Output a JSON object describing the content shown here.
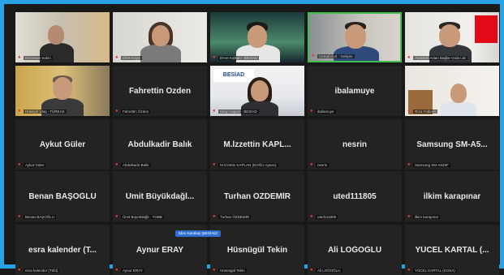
{
  "window": {
    "accent_color": "#2aa3e6",
    "active_speaker_color": "#3fbf4f"
  },
  "row1": [
    {
      "caption": "Esmehan Sahin",
      "icon": "person-video"
    },
    {
      "caption": "Dilek Kaya",
      "icon": "person-video"
    },
    {
      "caption": "Emre Kalkan - BESİAD",
      "icon": "person-video"
    },
    {
      "caption": "Cemal Kurt - Gelişim",
      "icon": "person-video"
    },
    {
      "caption": "Abdullah Aslan Bağlar Gıda Ltd",
      "icon": "person-video"
    }
  ],
  "row2": [
    {
      "caption": "Hüseyin Ulaş - TÜRKAK",
      "icon": "person-video"
    },
    {
      "name": "Fahrettin Özden",
      "caption": "Fahrettin Özden"
    },
    {
      "caption": "Nilay Kaplan - BESİAD",
      "logo": "BESİAD",
      "icon": "person-video"
    },
    {
      "name": "ibalamuye",
      "caption": "ibalamuye"
    },
    {
      "caption": "Rıza Yıldırım",
      "icon": "person-video"
    }
  ],
  "row3": [
    {
      "name": "Aykut Güler",
      "caption": "Aykut Güler"
    },
    {
      "name": "Abdulkadir Balık",
      "caption": "Abdulkadir Balık"
    },
    {
      "name": "M.İzzettin KAPL...",
      "caption": "M.İzzettin KAPLAN (DOĞU Ajansı)"
    },
    {
      "name": "nesrin",
      "caption": "nesrin"
    },
    {
      "name": "Samsung SM-A5...",
      "caption": "Samsung SM-A525F"
    }
  ],
  "row4": [
    {
      "name": "Benan BAŞOĞLU",
      "caption": "Benan BAŞOĞLU"
    },
    {
      "name": "Ümit Büyükdağl...",
      "caption": "Ümit Büyükdağlı - TOBB"
    },
    {
      "name": "Turhan ÖZDEMİR",
      "caption": "Turhan ÖZDEMİR"
    },
    {
      "name": "uted111805",
      "caption": "uted111805"
    },
    {
      "name": "ilkim karapınar",
      "caption": "ilkim karapınar"
    }
  ],
  "row5": [
    {
      "name": "esra kalender (T...",
      "caption": "esra kalender (Tübi)"
    },
    {
      "name": "Aynur ERAY",
      "caption": "Aynur ERAY"
    },
    {
      "name": "Hüsnügül Tekin",
      "caption": "Hüsnügül Tekin"
    },
    {
      "name": "Ali LOĞOĞLU",
      "caption": "Ali LOĞOĞLU"
    },
    {
      "name": "YÜCEL KARTAL (...",
      "caption": "YÜCEL KARTAL (KOSA)"
    }
  ],
  "floating_caption": "Ebru Karakaş (BESİAD)"
}
